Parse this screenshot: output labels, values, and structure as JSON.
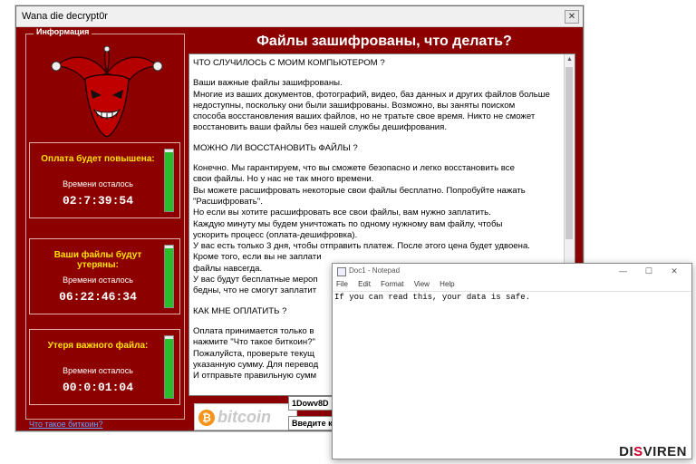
{
  "ransom_window": {
    "title": "Wana die decrypt0r",
    "close_glyph": "✕",
    "info_legend": "Информация",
    "main_heading": "Файлы зашифрованы, что делать?",
    "timers": [
      {
        "title": "Оплата будет повышена:",
        "label": "Времени осталось",
        "value": "02:7:39:54",
        "progress": 0.95,
        "color": "#2bbd2b"
      },
      {
        "title": "Ваши файлы будут утеряны:",
        "label": "Времени осталось",
        "value": "06:22:46:34",
        "progress": 0.95,
        "color": "#2bbd2b"
      },
      {
        "title": "Утеря важного файла:",
        "label": "Времени осталось",
        "value": "00:0:01:04",
        "progress": 0.95,
        "color": "#2bbd2b"
      }
    ],
    "message_lines": [
      "ЧТО СЛУЧИЛОСЬ С МОИМ КОМПЬЮТЕРОМ ?",
      "",
      "Ваши важные файлы зашифрованы.",
      "Многие из ваших документов, фотографий, видео, баз данных и других файлов больше",
      "недоступны, поскольку они были зашифрованы. Возможно, вы заняты поиском",
      "способа восстановления ваших файлов, но не тратьте свое время. Никто не сможет",
      "восстановить ваши файлы без нашей службы дешифрования.",
      "",
      "МОЖНО ЛИ ВОССТАНОВИТЬ ФАЙЛЫ ?",
      "",
      "Конечно. Мы гарантируем, что вы сможете безопасно и легко восстановить все",
      "свои файлы. Но у нас не так много времени.",
      "Вы можете расшифровать некоторые свои файлы бесплатно. Попробуйте нажать",
      "\"Расшифровать\".",
      "Но если вы хотите расшифровать все свои файлы, вам нужно заплатить.",
      "Каждую минуту мы будем уничтожать по одному нужному вам файлу, чтобы",
      "ускорить процесс (оплата-дешифровка).",
      "У вас есть только 3 дня, чтобы отправить платеж. После этого цена будет удвоена.",
      "Кроме того, если вы не заплати",
      "файлы навсегда.",
      "У вас будут бесплатные мероп",
      "бедны, что не смогут заплатит",
      "",
      "КАК МНЕ ОПЛАТИТЬ ?",
      "",
      "Оплата принимается только в",
      "нажмите \"Что такое биткоин?\"",
      "Пожалуйста, проверьте текущ",
      "указанную сумму. Для перевод",
      "И отправьте правильную сумм"
    ],
    "bitcoin_logo": "bitcoin",
    "bitcoin_symbol": "₿",
    "bitcoin_address": "1Dowv8D",
    "enter_button": "Введите к",
    "bitcoin_link": "Что такое биткоин?"
  },
  "notepad": {
    "title": "Doc1 - Notepad",
    "buttons": {
      "minimize": "—",
      "maximize": "☐",
      "close": "✕"
    },
    "menu": [
      "File",
      "Edit",
      "Format",
      "View",
      "Help"
    ],
    "content": "If you can read this, your data is safe."
  },
  "watermark": {
    "part1": "DI",
    "accent": "S",
    "part2": "VIREN"
  },
  "colors": {
    "window_bg": "#8d0000",
    "timer_title": "#ffe100",
    "progress": "#2bbd2b",
    "bitcoin": "#f7931a"
  }
}
